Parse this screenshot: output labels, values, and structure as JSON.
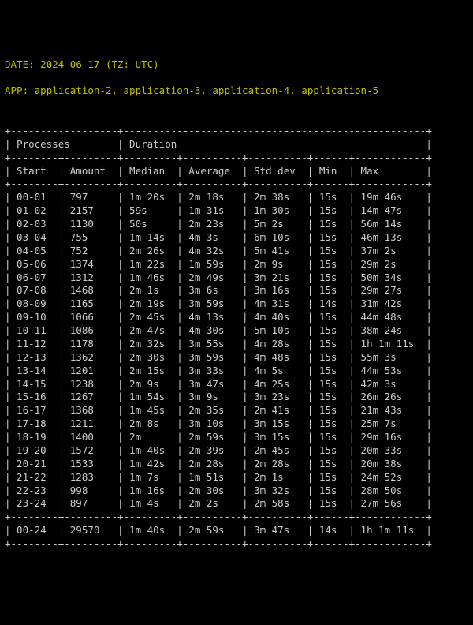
{
  "header": {
    "date_label": "DATE:",
    "date_value": "2024-06-17 (TZ: UTC)",
    "app_label": "APP:",
    "app_value": "application-2, application-3, application-4, application-5"
  },
  "group_headers": [
    "Processes",
    "Duration"
  ],
  "columns": [
    "Start",
    "Amount",
    "Median",
    "Average",
    "Std dev",
    "Min",
    "Max"
  ],
  "rows": [
    {
      "start": "00-01",
      "amount": "797",
      "median": "1m 20s",
      "average": "2m 18s",
      "stddev": "2m 38s",
      "min": "15s",
      "max": "19m 46s"
    },
    {
      "start": "01-02",
      "amount": "2157",
      "median": "59s",
      "average": "1m 31s",
      "stddev": "1m 30s",
      "min": "15s",
      "max": "14m 47s"
    },
    {
      "start": "02-03",
      "amount": "1130",
      "median": "50s",
      "average": "2m 23s",
      "stddev": "5m 2s",
      "min": "15s",
      "max": "56m 14s"
    },
    {
      "start": "03-04",
      "amount": "755",
      "median": "1m 14s",
      "average": "4m 3s",
      "stddev": "6m 10s",
      "min": "15s",
      "max": "46m 13s"
    },
    {
      "start": "04-05",
      "amount": "752",
      "median": "2m 26s",
      "average": "4m 32s",
      "stddev": "5m 41s",
      "min": "15s",
      "max": "37m 2s"
    },
    {
      "start": "05-06",
      "amount": "1374",
      "median": "1m 22s",
      "average": "1m 59s",
      "stddev": "2m 9s",
      "min": "15s",
      "max": "29m 2s"
    },
    {
      "start": "06-07",
      "amount": "1312",
      "median": "1m 46s",
      "average": "2m 49s",
      "stddev": "3m 21s",
      "min": "15s",
      "max": "50m 34s"
    },
    {
      "start": "07-08",
      "amount": "1468",
      "median": "2m 1s",
      "average": "3m 6s",
      "stddev": "3m 16s",
      "min": "15s",
      "max": "29m 27s"
    },
    {
      "start": "08-09",
      "amount": "1165",
      "median": "2m 19s",
      "average": "3m 59s",
      "stddev": "4m 31s",
      "min": "14s",
      "max": "31m 42s"
    },
    {
      "start": "09-10",
      "amount": "1066",
      "median": "2m 45s",
      "average": "4m 13s",
      "stddev": "4m 40s",
      "min": "15s",
      "max": "44m 48s"
    },
    {
      "start": "10-11",
      "amount": "1086",
      "median": "2m 47s",
      "average": "4m 30s",
      "stddev": "5m 10s",
      "min": "15s",
      "max": "38m 24s"
    },
    {
      "start": "11-12",
      "amount": "1178",
      "median": "2m 32s",
      "average": "3m 55s",
      "stddev": "4m 28s",
      "min": "15s",
      "max": "1h 1m 11s"
    },
    {
      "start": "12-13",
      "amount": "1362",
      "median": "2m 30s",
      "average": "3m 59s",
      "stddev": "4m 48s",
      "min": "15s",
      "max": "55m 3s"
    },
    {
      "start": "13-14",
      "amount": "1201",
      "median": "2m 15s",
      "average": "3m 33s",
      "stddev": "4m 5s",
      "min": "15s",
      "max": "44m 53s"
    },
    {
      "start": "14-15",
      "amount": "1238",
      "median": "2m 9s",
      "average": "3m 47s",
      "stddev": "4m 25s",
      "min": "15s",
      "max": "42m 3s"
    },
    {
      "start": "15-16",
      "amount": "1267",
      "median": "1m 54s",
      "average": "3m 9s",
      "stddev": "3m 23s",
      "min": "15s",
      "max": "26m 26s"
    },
    {
      "start": "16-17",
      "amount": "1368",
      "median": "1m 45s",
      "average": "2m 35s",
      "stddev": "2m 41s",
      "min": "15s",
      "max": "21m 43s"
    },
    {
      "start": "17-18",
      "amount": "1211",
      "median": "2m 8s",
      "average": "3m 10s",
      "stddev": "3m 15s",
      "min": "15s",
      "max": "25m 7s"
    },
    {
      "start": "18-19",
      "amount": "1400",
      "median": "2m",
      "average": "2m 59s",
      "stddev": "3m 15s",
      "min": "15s",
      "max": "29m 16s"
    },
    {
      "start": "19-20",
      "amount": "1572",
      "median": "1m 40s",
      "average": "2m 39s",
      "stddev": "2m 45s",
      "min": "15s",
      "max": "20m 33s"
    },
    {
      "start": "20-21",
      "amount": "1533",
      "median": "1m 42s",
      "average": "2m 28s",
      "stddev": "2m 28s",
      "min": "15s",
      "max": "20m 38s"
    },
    {
      "start": "21-22",
      "amount": "1283",
      "median": "1m 7s",
      "average": "1m 51s",
      "stddev": "2m 1s",
      "min": "15s",
      "max": "24m 52s"
    },
    {
      "start": "22-23",
      "amount": "998",
      "median": "1m 16s",
      "average": "2m 30s",
      "stddev": "3m 32s",
      "min": "15s",
      "max": "28m 50s"
    },
    {
      "start": "23-24",
      "amount": "897",
      "median": "1m 4s",
      "average": "2m 2s",
      "stddev": "2m 58s",
      "min": "15s",
      "max": "27m 56s"
    }
  ],
  "total": {
    "start": "00-24",
    "amount": "29570",
    "median": "1m 40s",
    "average": "2m 59s",
    "stddev": "3m 47s",
    "min": "14s",
    "max": "1h 1m 11s"
  }
}
